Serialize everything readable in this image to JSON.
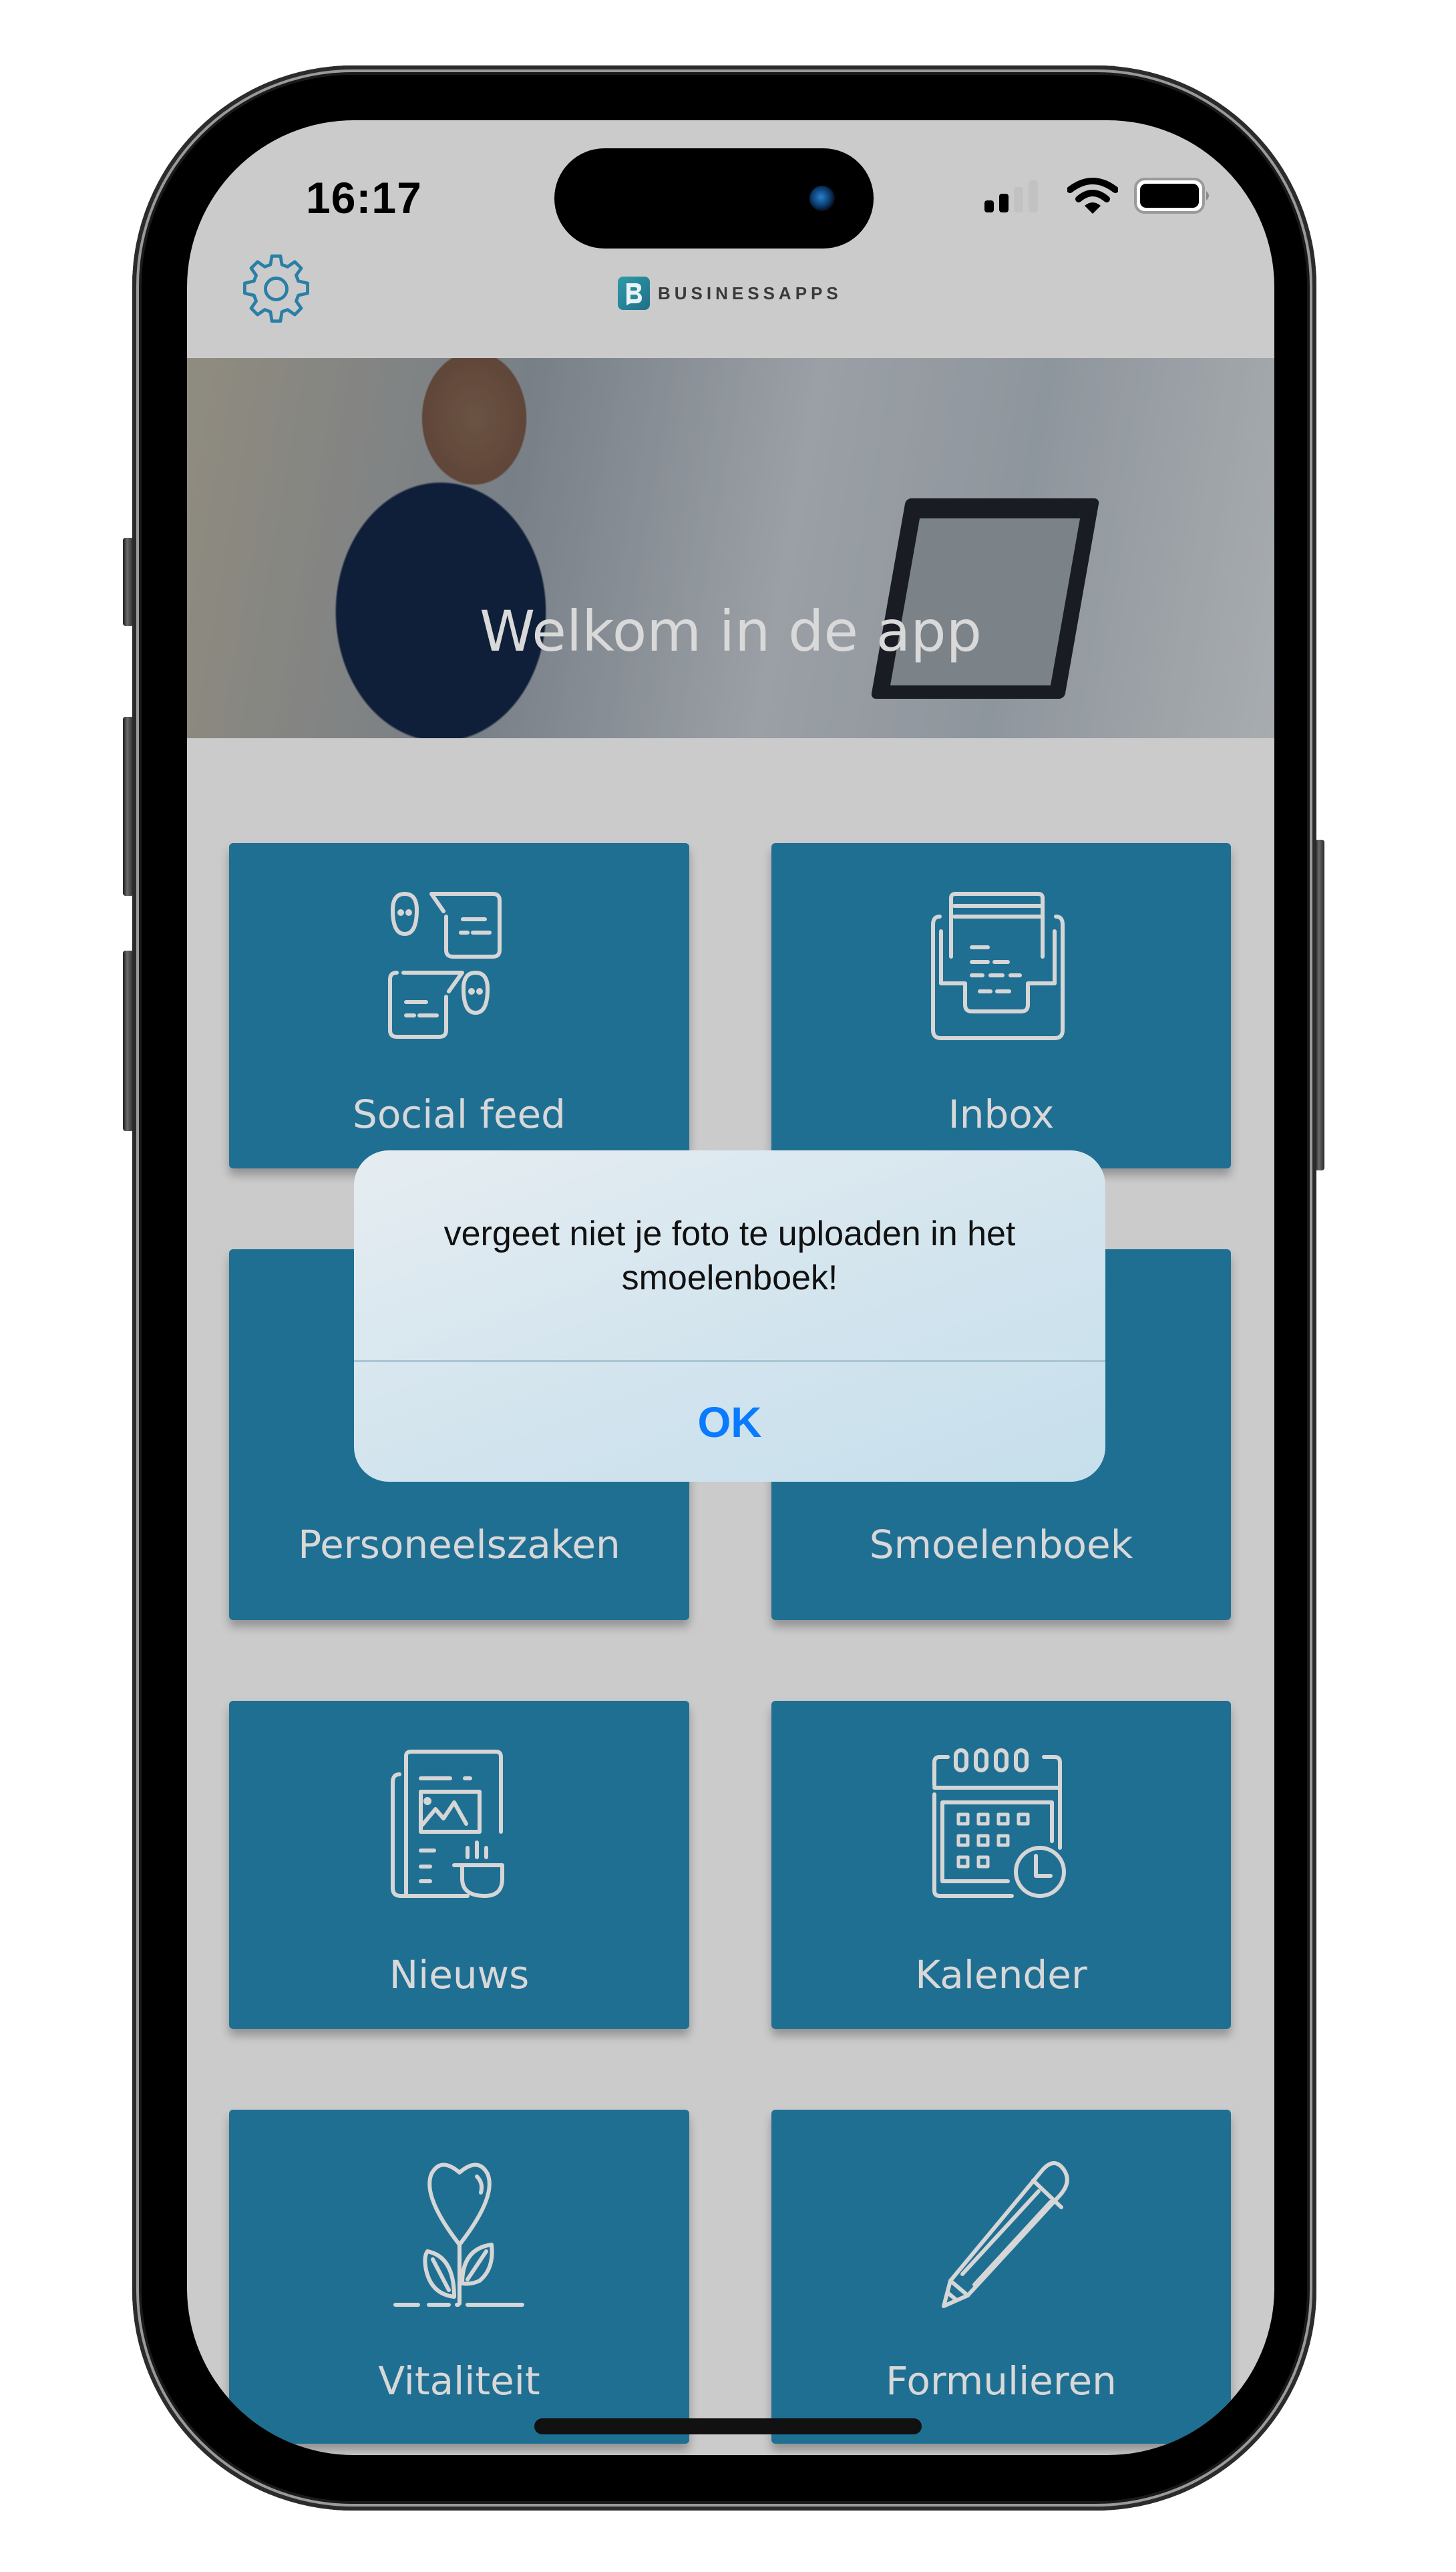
{
  "status_bar": {
    "time": "16:17",
    "signal_bars_active": 2,
    "signal_bars_total": 4,
    "wifi": "connected",
    "battery_level": "full"
  },
  "nav": {
    "settings_icon": "gear-icon",
    "logo_text": "BUSINESSAPPS",
    "logo_mark": "B"
  },
  "hero": {
    "title": "Welkom in de app"
  },
  "tiles": [
    {
      "label": "Social feed",
      "icon": "social-chat-icon"
    },
    {
      "label": "Inbox",
      "icon": "inbox-tray-icon"
    },
    {
      "label": "Personeelszaken",
      "icon": "hr-icon"
    },
    {
      "label": "Smoelenboek",
      "icon": "directory-icon"
    },
    {
      "label": "Nieuws",
      "icon": "newspaper-icon"
    },
    {
      "label": "Kalender",
      "icon": "calendar-clock-icon"
    },
    {
      "label": "Vitaliteit",
      "icon": "heart-plant-icon"
    },
    {
      "label": "Formulieren",
      "icon": "pencil-icon"
    }
  ],
  "alert": {
    "message": "vergeet niet je foto te uploaden in het smoelenboek!",
    "ok_label": "OK"
  },
  "colors": {
    "tile_bg": "#1f6f93",
    "screen_bg": "#cbcbcb",
    "accent_link": "#0a7aff",
    "gear": "#2a7fa6"
  }
}
